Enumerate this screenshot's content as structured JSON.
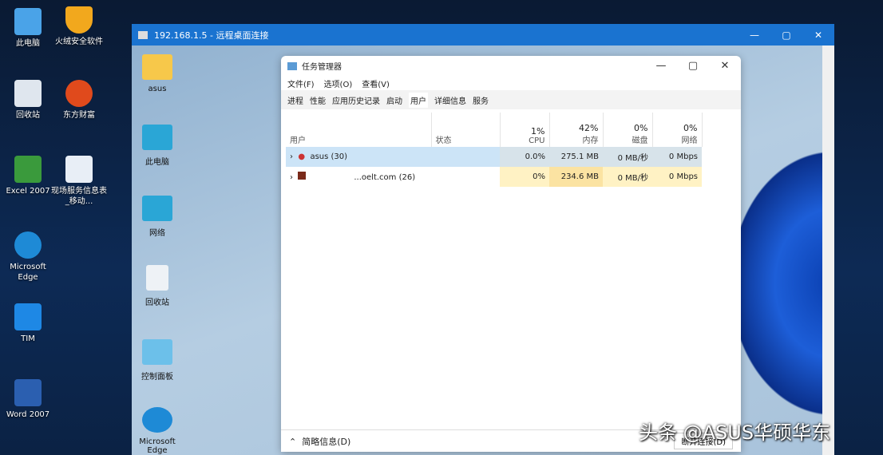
{
  "desktop": {
    "icons": [
      "此电脑",
      "火绒安全软件",
      "回收站",
      "东方财富",
      "Excel 2007",
      "现场服务信息表_移动...",
      "Microsoft Edge",
      "TIM",
      "Word 2007"
    ]
  },
  "rdp": {
    "title": "192.168.1.5 - 远程桌面连接",
    "icons": [
      "asus",
      "此电脑",
      "网络",
      "回收站",
      "控制面板",
      "Microsoft Edge"
    ]
  },
  "taskmgr": {
    "title": "任务管理器",
    "menu": [
      "文件(F)",
      "选项(O)",
      "查看(V)"
    ],
    "tabs": [
      "进程",
      "性能",
      "应用历史记录",
      "启动",
      "用户",
      "详细信息",
      "服务"
    ],
    "active_tab": "用户",
    "columns": {
      "user": "用户",
      "status": "状态",
      "cpu": "CPU",
      "mem": "内存",
      "disk": "磁盘",
      "net": "网络"
    },
    "totals": {
      "cpu": "1%",
      "mem": "42%",
      "disk": "0%",
      "net": "0%"
    },
    "rows": [
      {
        "name": "asus (30)",
        "status": "",
        "cpu": "0.0%",
        "mem": "275.1 MB",
        "disk": "0 MB/秒",
        "net": "0 Mbps"
      },
      {
        "name": "...oelt.com (26)",
        "status": "",
        "cpu": "0%",
        "mem": "234.6 MB",
        "disk": "0 MB/秒",
        "net": "0 Mbps"
      }
    ],
    "footer": {
      "less": "简略信息(D)",
      "disconnect": "断开连接(D)"
    }
  },
  "watermark": "头条 @ASUS华硕华东"
}
